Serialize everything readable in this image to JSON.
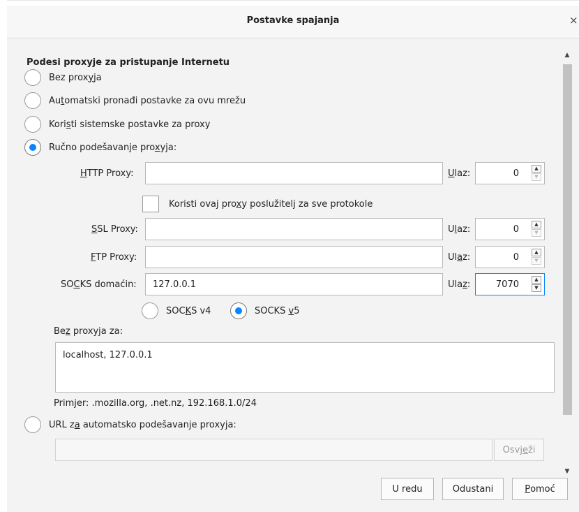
{
  "dialog": {
    "title": "Postavke spajanja",
    "close_glyph": "×"
  },
  "proxy": {
    "heading": "Podesi proxyje za pristupanje Internetu",
    "options": [
      {
        "pre": "Bez prox",
        "u": "y",
        "post": "ja",
        "checked": false
      },
      {
        "pre": "Au",
        "u": "t",
        "post": "omatski pronađi postavke za ovu mrežu",
        "checked": false
      },
      {
        "pre": "Kori",
        "u": "s",
        "post": "ti sistemske postavke za proxy",
        "checked": false
      },
      {
        "pre": "Ručno podešavanje pro",
        "u": "x",
        "post": "yja:",
        "checked": true
      }
    ],
    "http": {
      "label_u": "H",
      "label_rest": "TTP Proxy:",
      "value": "",
      "port_pre": "",
      "port_u": "U",
      "port_post": "laz:",
      "port": "0"
    },
    "use_for_all": {
      "pre": "Koristi ovaj pro",
      "u": "x",
      "post": "y poslužitelj za sve protokole",
      "checked": false
    },
    "ssl": {
      "label_u": "S",
      "label_rest": "SL Proxy:",
      "value": "",
      "port_pre": "U",
      "port_u": "l",
      "port_post": "az:",
      "port": "0"
    },
    "ftp": {
      "label_u": "F",
      "label_rest": "TP Proxy:",
      "value": "",
      "port_pre": "Ul",
      "port_u": "a",
      "port_post": "z:",
      "port": "0"
    },
    "socks": {
      "label_pre": "SO",
      "label_u": "C",
      "label_rest": "KS domaćin:",
      "value": "127.0.0.1",
      "port_pre": "Ula",
      "port_u": "z",
      "port_post": ":",
      "port": "7070"
    },
    "socks_v4": {
      "pre": "SOC",
      "u": "K",
      "post": "S v4",
      "checked": false
    },
    "socks_v5": {
      "pre": "SOCKS ",
      "u": "v",
      "post": "5",
      "checked": true
    },
    "no_proxy": {
      "pre": "Be",
      "u": "z",
      "post": " proxyja za:",
      "value": "localhost, 127.0.0.1"
    },
    "example": "Primjer: .mozilla.org, .net.nz, 192.168.1.0/24",
    "auto_url": {
      "pre": "URL z",
      "u": "a",
      "post": " automatsko podešavanje proxyja:",
      "value": "",
      "checked": false
    },
    "reload": {
      "pre": "Osvj",
      "u": "e",
      "post": "ži"
    }
  },
  "buttons": {
    "ok": "U redu",
    "cancel": "Odustani",
    "help_u": "P",
    "help_rest": "omoć"
  },
  "colors": {
    "accent": "#0a84ff",
    "dialog_bg": "#f3f3f3"
  }
}
